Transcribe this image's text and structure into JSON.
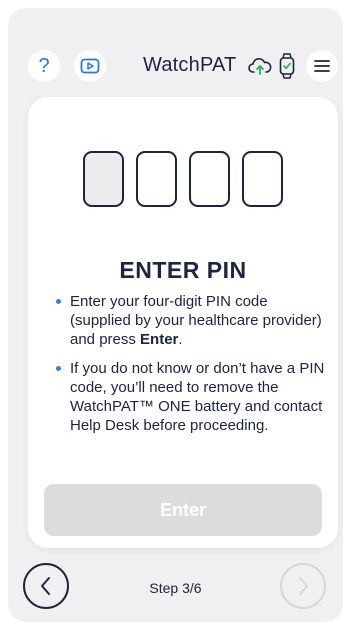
{
  "header": {
    "brand_bold": "Watch",
    "brand_thin": "PAT",
    "help_icon": "question-icon",
    "video_icon": "play-video-icon",
    "cloud_icon": "cloud-upload-icon",
    "watch_icon": "smartwatch-check-icon",
    "menu_icon": "hamburger-menu-icon"
  },
  "pin": {
    "digits": [
      "",
      "",
      "",
      ""
    ]
  },
  "card": {
    "title": "ENTER PIN",
    "bullet1_a": "Enter your four-digit PIN code (supplied  by your healthcare provider) and press ",
    "bullet1_b": "Enter",
    "bullet1_c": ".",
    "bullet2": "If you do not know or don’t have a PIN code, you’ll need to remove the WatchPAT™ ONE battery and contact Help Desk  before proceeding.",
    "enter_label": "Enter"
  },
  "footer": {
    "step": "Step 3/6"
  },
  "colors": {
    "navy": "#1b2440",
    "accent_blue": "#2f74e0",
    "upload_green": "#2bb34a",
    "disabled_button": "#dcdcde"
  }
}
